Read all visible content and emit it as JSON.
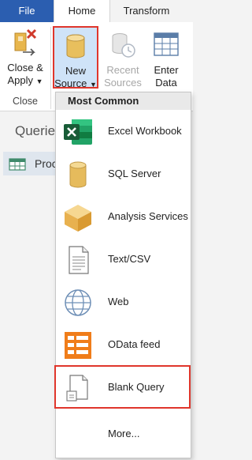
{
  "tabs": {
    "file": "File",
    "home": "Home",
    "transform": "Transform"
  },
  "ribbon": {
    "close_apply": {
      "line1": "Close &",
      "line2": "Apply"
    },
    "new_source": {
      "line1": "New",
      "line2": "Source"
    },
    "recent_sources": {
      "line1": "Recent",
      "line2": "Sources"
    },
    "enter_data": {
      "line1": "Enter",
      "line2": "Data"
    },
    "group_close_label": "Close"
  },
  "queries": {
    "title": "Querie",
    "row_label": "Proc"
  },
  "dropdown": {
    "header": "Most Common",
    "items": [
      {
        "label": "Excel Workbook",
        "icon": "excel-icon"
      },
      {
        "label": "SQL Server",
        "icon": "database-icon"
      },
      {
        "label": "Analysis Services",
        "icon": "analysis-cube-icon"
      },
      {
        "label": "Text/CSV",
        "icon": "text-file-icon"
      },
      {
        "label": "Web",
        "icon": "globe-icon"
      },
      {
        "label": "OData feed",
        "icon": "odata-icon"
      },
      {
        "label": "Blank Query",
        "icon": "blank-query-icon"
      }
    ],
    "more": "More..."
  },
  "colors": {
    "file_tab": "#2b5eb0",
    "highlight": "#e0362c",
    "selected_button": "#cfe3f8"
  }
}
